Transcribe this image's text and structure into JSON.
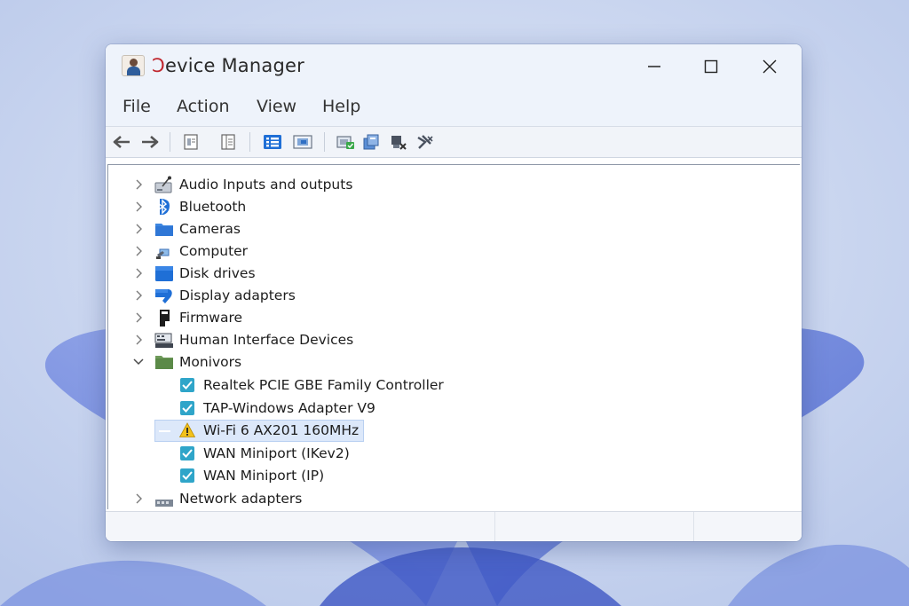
{
  "window": {
    "title": "Device Manager",
    "title_glyph_first": "Ɔ",
    "title_rest": "evice Manager"
  },
  "menu": {
    "items": [
      "File",
      "Action",
      "View",
      "Help"
    ]
  },
  "toolbar": {
    "buttons": [
      {
        "icon": "back-arrow-icon"
      },
      {
        "icon": "forward-arrow-icon"
      },
      {
        "icon": "properties-icon"
      },
      {
        "icon": "help-panel-icon"
      },
      {
        "icon": "show-hidden-view-icon"
      },
      {
        "icon": "device-view-icon"
      },
      {
        "icon": "scan-hardware-icon"
      },
      {
        "icon": "update-driver-icon"
      },
      {
        "icon": "uninstall-device-icon"
      },
      {
        "icon": "disable-device-icon"
      }
    ]
  },
  "tree": {
    "categories": [
      {
        "label": "Audio Inputs and outputs",
        "icon": "audio-icon",
        "expanded": false
      },
      {
        "label": "Bluetooth",
        "icon": "bluetooth-icon",
        "expanded": false
      },
      {
        "label": "Cameras",
        "icon": "camera-folder-icon",
        "expanded": false
      },
      {
        "label": "Computer",
        "icon": "computer-icon",
        "expanded": false
      },
      {
        "label": "Disk drives",
        "icon": "disk-drive-icon",
        "expanded": false
      },
      {
        "label": "Display adapters",
        "icon": "display-adapter-icon",
        "expanded": false
      },
      {
        "label": "Firmware",
        "icon": "firmware-icon",
        "expanded": false
      },
      {
        "label": "Human Interface Devices",
        "icon": "hid-icon",
        "expanded": false
      },
      {
        "label": "Monivors",
        "icon": "monitor-folder-icon",
        "expanded": true,
        "children": [
          {
            "label": "Realtek PCIE GBE Family Controller",
            "icon": "network-device-icon",
            "status": "ok"
          },
          {
            "label": "TAP-Windows Adapter V9",
            "icon": "network-device-icon",
            "status": "ok"
          },
          {
            "label": "Wi-Fi 6 AX201 160MHz",
            "icon": "warning-icon",
            "status": "warning",
            "selected": true
          },
          {
            "label": "WAN Miniport (IKev2)",
            "icon": "network-device-icon",
            "status": "ok"
          },
          {
            "label": "WAN Miniport (IP)",
            "icon": "network-device-icon",
            "status": "ok"
          }
        ]
      },
      {
        "label": "Network adapters",
        "icon": "network-adapter-icon",
        "expanded": false
      }
    ]
  },
  "colors": {
    "accent": "#1f6fd6",
    "warning": "#f3c21b",
    "check": "#2fa5c9",
    "selection": "#dce8fa"
  }
}
